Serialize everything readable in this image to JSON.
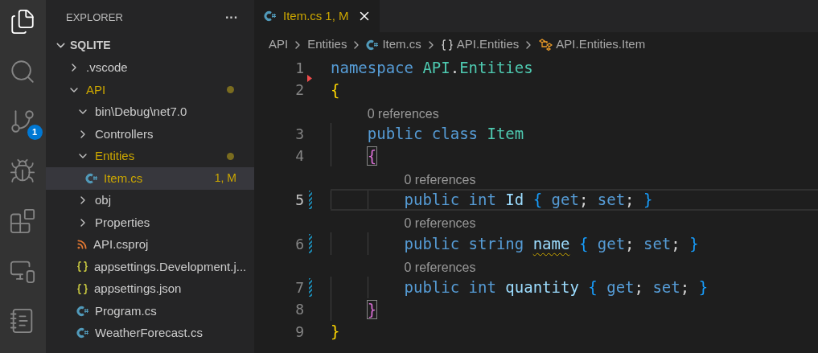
{
  "activity_bar": [
    {
      "kind": "files",
      "selected": true
    },
    {
      "kind": "search",
      "selected": false
    },
    {
      "kind": "branch",
      "selected": false,
      "badge": "1"
    },
    {
      "kind": "debug",
      "selected": false
    },
    {
      "kind": "extensions",
      "selected": false
    },
    {
      "kind": "remote",
      "selected": false
    },
    {
      "kind": "notebook",
      "selected": false
    }
  ],
  "sidebar": {
    "title": "EXPLORER",
    "more": "···",
    "workspace": {
      "title": "SQLITE",
      "expanded": true,
      "items": [
        {
          "kind": "folder",
          "name": ".vscode",
          "expanded": false,
          "modified": false
        },
        {
          "kind": "folder",
          "name": "API",
          "expanded": true,
          "modified": true,
          "children": [
            {
              "kind": "folder",
              "name": "bin\\Debug\\net7.0",
              "expanded": true,
              "modified": false
            },
            {
              "kind": "folder",
              "name": "Controllers",
              "expanded": false,
              "modified": false
            },
            {
              "kind": "folder",
              "name": "Entities",
              "expanded": true,
              "modified": true,
              "children": [
                {
                  "kind": "csharp",
                  "name": "Item.cs",
                  "modified": true,
                  "selected": true,
                  "badge": "1, M"
                }
              ]
            },
            {
              "kind": "folder",
              "name": "obj",
              "expanded": false,
              "modified": false
            },
            {
              "kind": "folder",
              "name": "Properties",
              "expanded": false,
              "modified": false
            },
            {
              "kind": "rss",
              "name": "API.csproj",
              "modified": false,
              "selected": false
            },
            {
              "kind": "json",
              "name": "appsettings.Development.j...",
              "modified": false,
              "selected": false
            },
            {
              "kind": "json",
              "name": "appsettings.json",
              "modified": false,
              "selected": false
            },
            {
              "kind": "csharp",
              "name": "Program.cs",
              "modified": false,
              "selected": false
            },
            {
              "kind": "csharp",
              "name": "WeatherForecast.cs",
              "modified": false,
              "selected": false
            }
          ]
        }
      ]
    }
  },
  "tabs": [
    {
      "label": "Item.cs",
      "badge": "1, M",
      "selected": true,
      "modified": true
    }
  ],
  "breadcrumbs": [
    {
      "kind": "folder",
      "text": "API"
    },
    {
      "kind": "folder",
      "text": "Entities"
    },
    {
      "kind": "csharp",
      "text": "Item.cs"
    },
    {
      "kind": "namespace",
      "text": "API.Entities"
    },
    {
      "kind": "class",
      "text": "API.Entities.Item"
    }
  ],
  "code": [
    {
      "kind": "code",
      "number": "1",
      "current": false,
      "modified": false,
      "deleted": true,
      "tokens": [
        {
          "kind": "keyword",
          "text": "namespace "
        },
        {
          "kind": "type",
          "text": "API"
        },
        {
          "kind": "plain",
          "text": "."
        },
        {
          "kind": "type",
          "text": "Entities"
        }
      ]
    },
    {
      "kind": "code",
      "number": "2",
      "current": false,
      "modified": false,
      "deleted": false,
      "tokens": [
        {
          "kind": "brace_gold",
          "text": "{"
        }
      ]
    },
    {
      "kind": "lens",
      "text": "0 references"
    },
    {
      "kind": "code",
      "number": "3",
      "current": false,
      "modified": false,
      "deleted": false,
      "tokens": [
        {
          "kind": "keyword",
          "text": "    public class "
        },
        {
          "kind": "type",
          "text": "Item"
        }
      ]
    },
    {
      "kind": "code",
      "number": "4",
      "current": false,
      "modified": false,
      "deleted": false,
      "tokens": [
        {
          "kind": "bracket_matched",
          "text": "    {"
        }
      ]
    },
    {
      "kind": "lens",
      "text": "0 references"
    },
    {
      "kind": "code",
      "number": "5",
      "current": true,
      "modified": true,
      "deleted": false,
      "tokens": [
        {
          "kind": "keyword",
          "text": "        public int "
        },
        {
          "kind": "ident",
          "text": "Id "
        },
        {
          "kind": "brace_blue",
          "text": "{ "
        },
        {
          "kind": "keyword",
          "text": "get"
        },
        {
          "kind": "plain",
          "text": "; "
        },
        {
          "kind": "keyword",
          "text": "set"
        },
        {
          "kind": "plain",
          "text": "; "
        },
        {
          "kind": "brace_blue",
          "text": "}"
        }
      ]
    },
    {
      "kind": "lens",
      "text": "0 references"
    },
    {
      "kind": "code",
      "number": "6",
      "current": false,
      "modified": true,
      "deleted": false,
      "tokens": [
        {
          "kind": "keyword",
          "text": "        public string "
        },
        {
          "kind": "warning",
          "text": "name"
        },
        {
          "kind": "brace_blue",
          "text": " { "
        },
        {
          "kind": "keyword",
          "text": "get"
        },
        {
          "kind": "plain",
          "text": "; "
        },
        {
          "kind": "keyword",
          "text": "set"
        },
        {
          "kind": "plain",
          "text": "; "
        },
        {
          "kind": "brace_blue",
          "text": "}"
        }
      ]
    },
    {
      "kind": "lens",
      "text": "0 references"
    },
    {
      "kind": "code",
      "number": "7",
      "current": false,
      "modified": true,
      "deleted": false,
      "tokens": [
        {
          "kind": "keyword",
          "text": "        public int "
        },
        {
          "kind": "ident",
          "text": "quantity "
        },
        {
          "kind": "brace_blue",
          "text": "{ "
        },
        {
          "kind": "keyword",
          "text": "get"
        },
        {
          "kind": "plain",
          "text": "; "
        },
        {
          "kind": "keyword",
          "text": "set"
        },
        {
          "kind": "plain",
          "text": "; "
        },
        {
          "kind": "brace_blue",
          "text": "}"
        }
      ]
    },
    {
      "kind": "code",
      "number": "8",
      "current": false,
      "modified": false,
      "deleted": false,
      "tokens": [
        {
          "kind": "bracket_matched",
          "text": "    }"
        }
      ]
    },
    {
      "kind": "code",
      "number": "9",
      "current": false,
      "modified": false,
      "deleted": false,
      "tokens": [
        {
          "kind": "brace_gold",
          "text": "}"
        }
      ]
    }
  ]
}
